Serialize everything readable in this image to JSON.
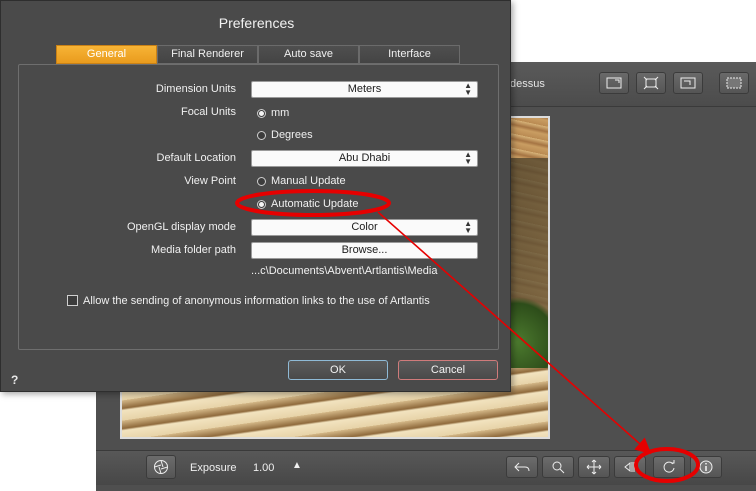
{
  "app": {
    "view_title": "dessus",
    "bottom_bar": {
      "exposure_label": "Exposure",
      "exposure_value": "1.00",
      "exposure_arrow": "▲"
    },
    "icons": [
      "frame-icon",
      "fit-icon",
      "zoom-frame-icon",
      "preview-icon",
      "camera-aperture-icon",
      "undo-icon",
      "zoom-icon",
      "pan-icon",
      "navigate-icon",
      "refresh-icon",
      "info-icon"
    ]
  },
  "dialog": {
    "title": "Preferences",
    "tabs": [
      {
        "label": "General",
        "active": true
      },
      {
        "label": "Final Renderer",
        "active": false
      },
      {
        "label": "Auto save",
        "active": false
      },
      {
        "label": "Interface",
        "active": false
      }
    ],
    "dimension_units": {
      "label": "Dimension Units",
      "value": "Meters"
    },
    "focal_units": {
      "label": "Focal Units",
      "options": [
        {
          "label": "mm",
          "selected": true
        },
        {
          "label": "Degrees",
          "selected": false
        }
      ]
    },
    "default_location": {
      "label": "Default Location",
      "value": "Abu Dhabi"
    },
    "view_point": {
      "label": "View Point",
      "options": [
        {
          "label": "Manual Update",
          "selected": false
        },
        {
          "label": "Automatic Update",
          "selected": true
        }
      ]
    },
    "opengl_mode": {
      "label": "OpenGL display mode",
      "value": "Color"
    },
    "media_folder": {
      "label": "Media folder path",
      "button": "Browse...",
      "path": "...c\\Documents\\Abvent\\Artlantis\\Media"
    },
    "anonymous_info": {
      "label": "Allow the sending of anonymous information links to the use of Artlantis",
      "checked": false
    },
    "ok_label": "OK",
    "cancel_label": "Cancel",
    "help_label": "?"
  },
  "colors": {
    "active_tab": "#f0a72a",
    "annotation": "#e60000",
    "dialog_bg": "#4a4a4a",
    "app_bg": "#4f4f4f"
  }
}
